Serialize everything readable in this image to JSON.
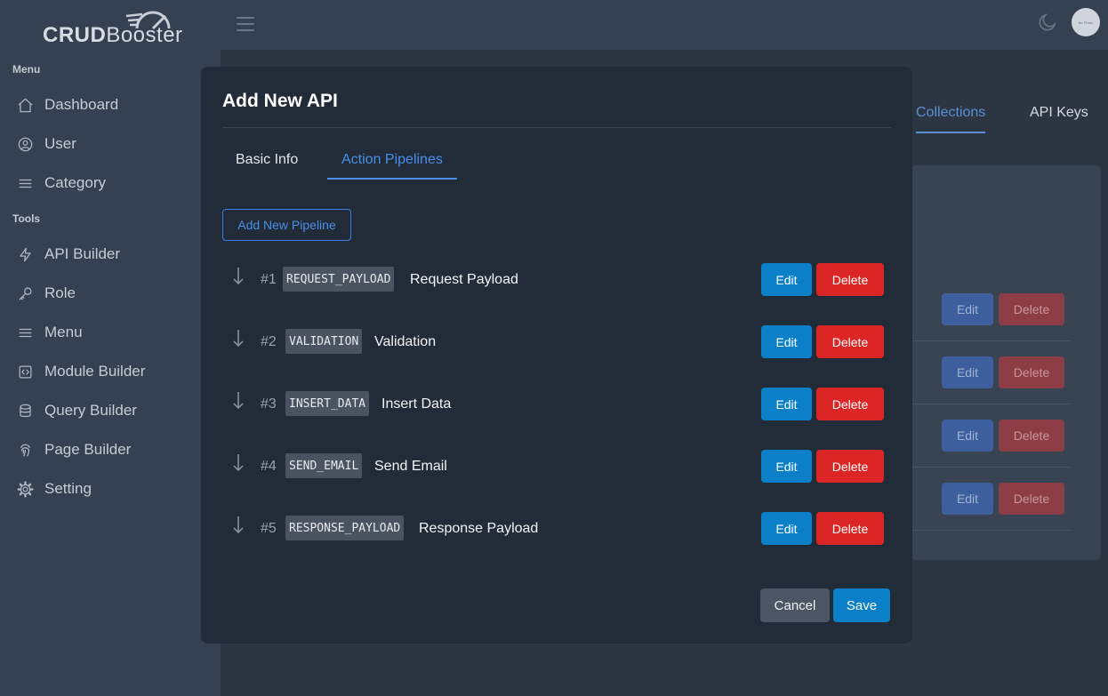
{
  "app": {
    "logo_bold": "CRUD",
    "logo_light": "Booster"
  },
  "sidebar": {
    "sections": [
      {
        "label": "Menu",
        "items": [
          {
            "label": "Dashboard",
            "icon": "home-icon"
          },
          {
            "label": "User",
            "icon": "user-circle-icon"
          },
          {
            "label": "Category",
            "icon": "list-icon"
          }
        ]
      },
      {
        "label": "Tools",
        "items": [
          {
            "label": "API Builder",
            "icon": "bolt-icon"
          },
          {
            "label": "Role",
            "icon": "key-icon"
          },
          {
            "label": "Menu",
            "icon": "list-icon"
          },
          {
            "label": "Module Builder",
            "icon": "code-square-icon"
          },
          {
            "label": "Query Builder",
            "icon": "database-icon"
          },
          {
            "label": "Page Builder",
            "icon": "fingerprint-icon"
          },
          {
            "label": "Setting",
            "icon": "gear-icon"
          }
        ]
      }
    ]
  },
  "header": {
    "avatar_text": "No Photo"
  },
  "background": {
    "tabs": [
      "Collections",
      "API Keys"
    ],
    "row_actions": {
      "edit": "Edit",
      "delete": "Delete"
    }
  },
  "modal": {
    "title": "Add New API",
    "tabs": [
      "Basic Info",
      "Action Pipelines"
    ],
    "active_tab": "Action Pipelines",
    "add_button": "Add New Pipeline",
    "pipelines": [
      {
        "num": "#1",
        "code": "REQUEST_PAYLOAD",
        "name": "Request Payload"
      },
      {
        "num": "#2",
        "code": "VALIDATION",
        "name": "Validation"
      },
      {
        "num": "#3",
        "code": "INSERT_DATA",
        "name": "Insert Data"
      },
      {
        "num": "#4",
        "code": "SEND_EMAIL",
        "name": "Send Email"
      },
      {
        "num": "#5",
        "code": "RESPONSE_PAYLOAD",
        "name": "Response Payload"
      }
    ],
    "edit_label": "Edit",
    "delete_label": "Delete",
    "cancel_label": "Cancel",
    "save_label": "Save"
  },
  "colors": {
    "primary": "#0b80c8",
    "danger": "#dc2626",
    "accent": "#4a8ee8"
  }
}
